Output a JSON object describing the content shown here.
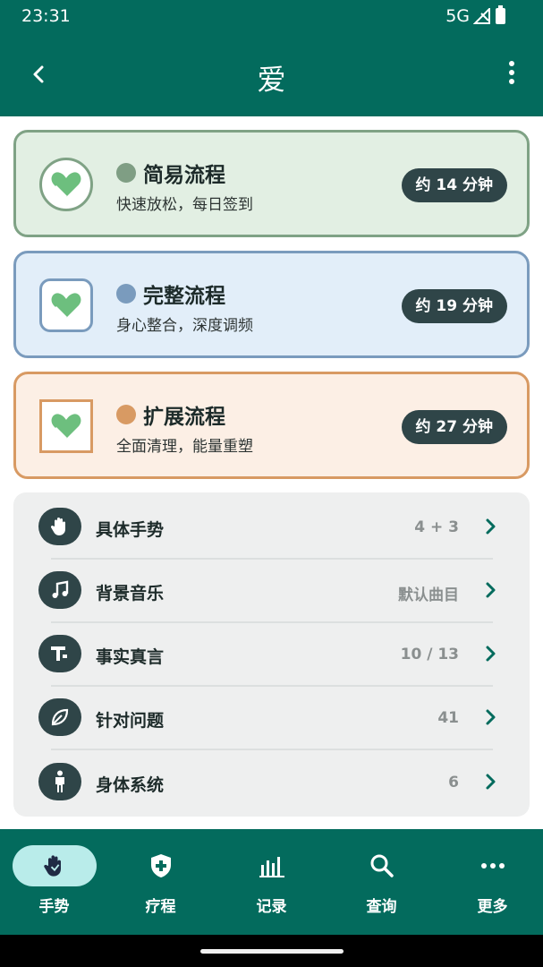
{
  "status_bar": {
    "time": "23:31",
    "network": "5G"
  },
  "app_bar": {
    "title": "爱",
    "back_icon": "arrow-back-icon",
    "menu_icon": "more-vert-icon"
  },
  "flows": [
    {
      "name": "简易流程",
      "desc": "快速放松，每日签到",
      "duration": "约 14 分钟",
      "color": "#7f9e84"
    },
    {
      "name": "完整流程",
      "desc": "身心整合，深度调频",
      "duration": "约 19 分钟",
      "color": "#7a9bbd"
    },
    {
      "name": "扩展流程",
      "desc": "全面清理，能量重塑",
      "duration": "约 27 分钟",
      "color": "#d89a63"
    }
  ],
  "settings": [
    {
      "label": "具体手势",
      "value": "4 + 3",
      "icon": "hand-icon"
    },
    {
      "label": "背景音乐",
      "value": "默认曲目",
      "icon": "music-note-icon"
    },
    {
      "label": "事实真言",
      "value": "10 / 13",
      "icon": "text-icon"
    },
    {
      "label": "针对问题",
      "value": "41",
      "icon": "leaf-icon"
    },
    {
      "label": "身体系统",
      "value": "6",
      "icon": "person-icon"
    }
  ],
  "bottom_nav": [
    {
      "label": "手势",
      "icon": "hand-icon",
      "active": true
    },
    {
      "label": "疗程",
      "icon": "shield-plus-icon",
      "active": false
    },
    {
      "label": "记录",
      "icon": "bar-chart-icon",
      "active": false
    },
    {
      "label": "查询",
      "icon": "search-icon",
      "active": false
    },
    {
      "label": "更多",
      "icon": "more-horiz-icon",
      "active": false
    }
  ],
  "colors": {
    "primary": "#036b5d",
    "pill": "#2f4548",
    "heart": "#6dbf7e"
  }
}
